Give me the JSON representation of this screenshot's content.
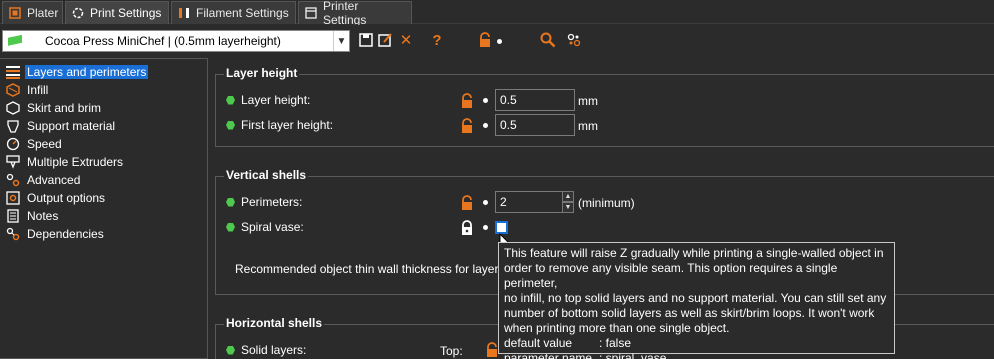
{
  "tabs": [
    {
      "label": "Plater",
      "icon": "plater-icon"
    },
    {
      "label": "Print Settings",
      "icon": "print-settings-icon"
    },
    {
      "label": "Filament Settings",
      "icon": "filament-icon"
    },
    {
      "label": "Printer Settings",
      "icon": "printer-icon"
    }
  ],
  "toolbar": {
    "preset_value": "Cocoa Press MiniChef  |  (0.5mm layerheight)",
    "help_label": "?"
  },
  "sidebar": {
    "items": [
      {
        "label": "Layers and perimeters",
        "icon": "layers-icon"
      },
      {
        "label": "Infill",
        "icon": "infill-icon"
      },
      {
        "label": "Skirt and brim",
        "icon": "skirt-icon"
      },
      {
        "label": "Support material",
        "icon": "support-icon"
      },
      {
        "label": "Speed",
        "icon": "speed-icon"
      },
      {
        "label": "Multiple Extruders",
        "icon": "extruders-icon"
      },
      {
        "label": "Advanced",
        "icon": "advanced-icon"
      },
      {
        "label": "Output options",
        "icon": "output-icon"
      },
      {
        "label": "Notes",
        "icon": "notes-icon"
      },
      {
        "label": "Dependencies",
        "icon": "dependencies-icon"
      }
    ]
  },
  "layer_height": {
    "title": "Layer height",
    "layer_height_label": "Layer height:",
    "layer_height_value": "0.5",
    "first_layer_label": "First layer height:",
    "first_layer_value": "0.5",
    "unit": "mm"
  },
  "vertical_shells": {
    "title": "Vertical shells",
    "perimeters_label": "Perimeters:",
    "perimeters_value": "2",
    "perimeters_unit": "(minimum)",
    "spiral_label": "Spiral vase:",
    "recommended_text": "Recommended object thin wall thickness for layer"
  },
  "horizontal_shells": {
    "title": "Horizontal shells",
    "solid_layers_label": "Solid layers:",
    "top_label": "Top:"
  },
  "tooltip": {
    "lines": [
      "This feature will raise Z gradually while printing a single-walled object in",
      "order to remove any visible seam. This option requires a single perimeter,",
      "no infill, no top solid layers and no support material. You can still set any",
      "number of bottom solid layers as well as skirt/brim loops. It won't work",
      "when printing more than one single object."
    ],
    "default_key": "default value",
    "default_val": ": false",
    "param_key": "parameter name",
    "param_val": ": spiral_vase"
  },
  "colors": {
    "accent": "#1a6fd6",
    "lock": "#e8761f",
    "dot": "#4ec94e"
  }
}
